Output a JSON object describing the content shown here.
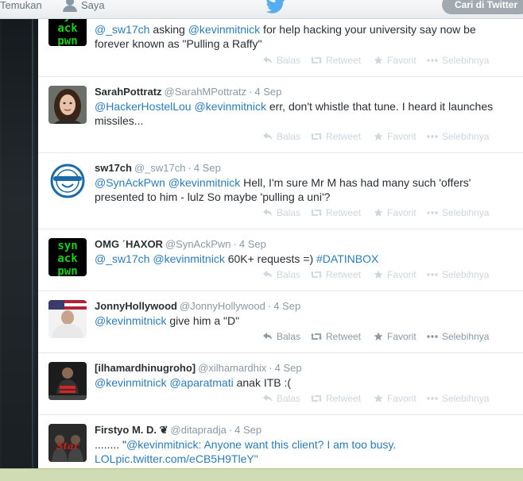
{
  "topbar": {
    "find_label": "Temukan",
    "me_label": "Saya",
    "search_label": "Cari di Twitter"
  },
  "actions": {
    "reply": "Balas",
    "retweet": "Retweet",
    "favorite": "Favorit",
    "more": "Selebihnya"
  },
  "tweets": [
    {
      "avatar": "synackpwn-logo",
      "parts": [
        {
          "t": "@_sw17ch",
          "k": "mention"
        },
        {
          "t": " asking ",
          "k": "plain"
        },
        {
          "t": "@kevinmitnick",
          "k": "mention"
        },
        {
          "t": " for help hacking your university say now be forever known as \"Pulling a Raffy\"",
          "k": "plain"
        }
      ]
    },
    {
      "fullname": "SarahPottratz",
      "username": "@SarahMPottratz",
      "time": "4 Sep",
      "avatar": "woman-portrait",
      "parts": [
        {
          "t": "@HackerHostelLou",
          "k": "mention"
        },
        {
          "t": " ",
          "k": "plain"
        },
        {
          "t": "@kevinmitnick",
          "k": "mention"
        },
        {
          "t": " err, don't whistle that tune. I heard it launches missiles...",
          "k": "plain"
        }
      ]
    },
    {
      "fullname": "sw17ch",
      "username": "@_sw17ch",
      "time": "4 Sep",
      "avatar": "laughing-man-logo",
      "parts": [
        {
          "t": "@SynAckPwn",
          "k": "mention"
        },
        {
          "t": " ",
          "k": "plain"
        },
        {
          "t": "@kevinmitnick",
          "k": "mention"
        },
        {
          "t": " Hell, I'm sure Mr M has had many such 'offers' presented to him - lulz So maybe 'pulling a uni'?",
          "k": "plain"
        }
      ]
    },
    {
      "fullname": "OMG ˊHAXOR",
      "username": "@SynAckPwn",
      "time": "4 Sep",
      "avatar": "synackpwn-logo",
      "parts": [
        {
          "t": "@_sw17ch",
          "k": "mention"
        },
        {
          "t": " ",
          "k": "plain"
        },
        {
          "t": "@kevinmitnick",
          "k": "mention"
        },
        {
          "t": " 60K+ requests =) ",
          "k": "plain"
        },
        {
          "t": "#DATINBOX",
          "k": "hashtag"
        }
      ]
    },
    {
      "fullname": "JonnyHollywood",
      "username": "@JonnyHollywood",
      "time": "4 Sep",
      "avatar": "flag-portrait",
      "parts": [
        {
          "t": "@kevinmitnick",
          "k": "mention"
        },
        {
          "t": " give him a \"D\"",
          "k": "plain"
        }
      ]
    },
    {
      "fullname": "[ilhamardhinugroho]",
      "username": "@xilhamardhix",
      "time": "4 Sep",
      "avatar": "person-poster",
      "parts": [
        {
          "t": "@kevinmitnick",
          "k": "mention"
        },
        {
          "t": " ",
          "k": "plain"
        },
        {
          "t": "@aparatmati",
          "k": "mention"
        },
        {
          "t": " anak ITB :(",
          "k": "plain"
        }
      ]
    },
    {
      "fullname": "Firstyo M. D. ❦",
      "username": "@ditapradja",
      "time": "4 Sep",
      "avatar": "band-poster",
      "parts": [
        {
          "t": "........ \"",
          "k": "plain"
        },
        {
          "t": "@kevinmitnick",
          "k": "mention"
        },
        {
          "t": ": Anyone want this client? I am too busy. LOL",
          "k": "quote"
        },
        {
          "t": "pic.twitter.com/eCB5H9TleY",
          "k": "link"
        },
        {
          "t": "\"",
          "k": "quote"
        }
      ]
    }
  ],
  "colors": {
    "mention": "#2b7bb9",
    "text": "#292f33",
    "meta": "#8899a6",
    "action_idle": "#ccd6dd",
    "action_hover": "#8899a6"
  }
}
